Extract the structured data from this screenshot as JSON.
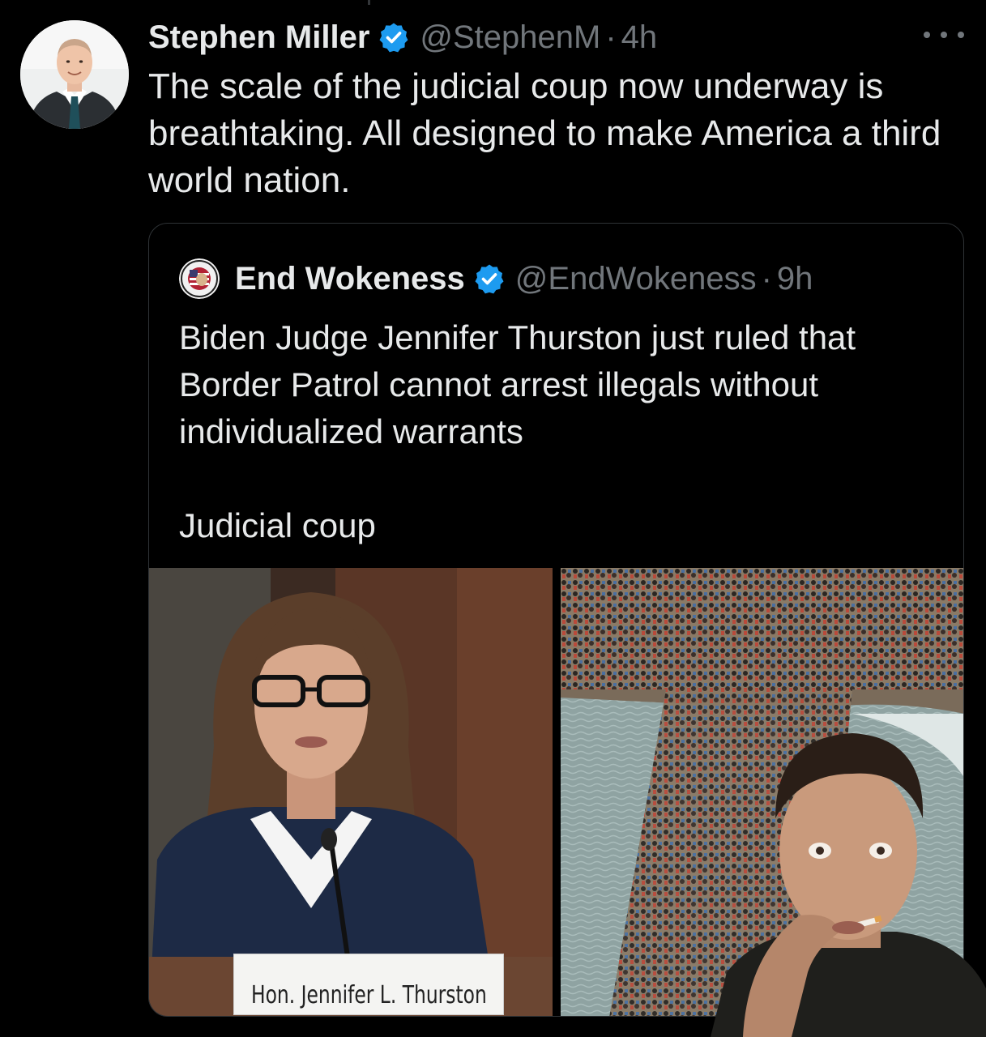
{
  "tweet": {
    "author_name": "Stephen Miller",
    "handle": "@StephenM",
    "separator": "·",
    "time": "4h",
    "text": "The scale of the judicial coup now underway is breathtaking. All designed to make America a third world nation.",
    "verified_icon": "verified-badge-icon",
    "more_icon": "more-options-icon"
  },
  "quoted_tweet": {
    "author_name": "End Wokeness",
    "handle": "@EndWokeness",
    "separator": "·",
    "time": "9h",
    "text": "Biden Judge Jennifer Thurston just ruled that Border Patrol cannot arrest illegals without individualized warrants\n\nJudicial coup",
    "media": {
      "left_image_nameplate": "Hon. Jennifer L. Thurston"
    }
  },
  "colors": {
    "background": "#000000",
    "text_primary": "#e7e9ea",
    "text_secondary": "#71767b",
    "verified_blue": "#1d9bf0",
    "border": "#2f3336"
  }
}
